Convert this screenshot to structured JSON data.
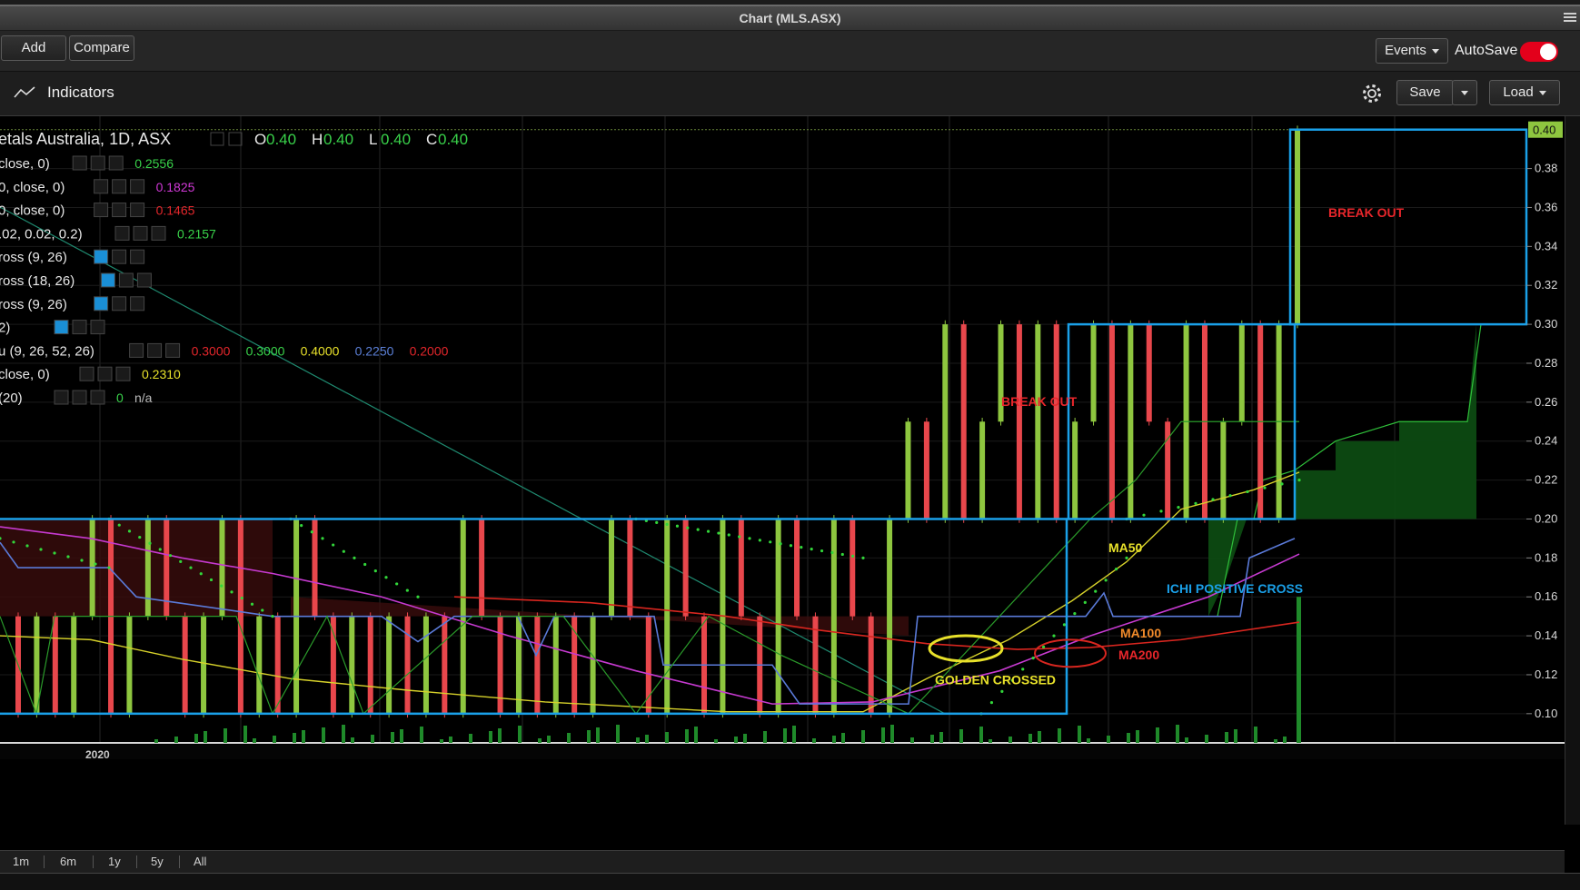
{
  "window": {
    "title": "Chart (MLS.ASX)"
  },
  "toolbar": {
    "add_label": "Add",
    "compare_label": "Compare",
    "events_label": "Events",
    "autosave_label": "AutoSave",
    "autosave_on": true,
    "accent_color": "#e3001b"
  },
  "indicators_bar": {
    "label": "Indicators",
    "save_label": "Save",
    "load_label": "Load"
  },
  "range_buttons": [
    "1m",
    "6m",
    "1y",
    "5y",
    "All"
  ],
  "legend": {
    "instrument": "etals Australia, 1D, ASX",
    "ohlc": [
      {
        "key": "O",
        "value": "0.40"
      },
      {
        "key": "H",
        "value": "0.40"
      },
      {
        "key": "L",
        "value": "0.40"
      },
      {
        "key": "C",
        "value": "0.40"
      }
    ],
    "studies": [
      {
        "name": "close, 0)",
        "values": [
          {
            "text": "0.2556",
            "color": "#39d24a"
          }
        ]
      },
      {
        "name": "0, close, 0)",
        "values": [
          {
            "text": "0.1825",
            "color": "#d038d6"
          }
        ]
      },
      {
        "name": "0, close, 0)",
        "values": [
          {
            "text": "0.1465",
            "color": "#e3262b"
          }
        ]
      },
      {
        "name": ".02, 0.02, 0.2)",
        "values": [
          {
            "text": "0.2157",
            "color": "#39d24a"
          }
        ]
      },
      {
        "name": "ross (9, 26)",
        "values": []
      },
      {
        "name": "ross (18, 26)",
        "values": []
      },
      {
        "name": "ross (9, 26)",
        "values": []
      },
      {
        "name": " 2)",
        "values": []
      },
      {
        "name": "u (9, 26, 52, 26)",
        "values": [
          {
            "text": "0.3000",
            "color": "#e3262b"
          },
          {
            "text": "0.3000",
            "color": "#39d24a"
          },
          {
            "text": "0.4000",
            "color": "#e8e12a"
          },
          {
            "text": "0.2250",
            "color": "#5b7fd6"
          },
          {
            "text": "0.2000",
            "color": "#e3262b"
          }
        ]
      },
      {
        "name": " close, 0)",
        "values": [
          {
            "text": "0.2310",
            "color": "#e8e12a"
          }
        ]
      },
      {
        "name": " (20)",
        "values": [
          {
            "text": "0",
            "color": "#39d24a"
          },
          {
            "text": "n/a",
            "color": "#bbbbbb"
          }
        ]
      }
    ]
  },
  "annotations": {
    "breakout_upper": "BREAK OUT",
    "breakout_mid": "BREAK OUT",
    "ma50": "MA50",
    "ma100": "MA100",
    "ma200": "MA200",
    "ichi_cross": "ICHI POSITIVE CROSS",
    "golden_cross": "GOLDEN CROSSED"
  },
  "chart_data": {
    "type": "candlestick",
    "x_tick_labels": [
      "2020"
    ],
    "y_axis": {
      "ylim": [
        0.085,
        0.405
      ],
      "ticks": [
        "0.10",
        "0.12",
        "0.14",
        "0.16",
        "0.18",
        "0.20",
        "0.22",
        "0.24",
        "0.26",
        "0.28",
        "0.30",
        "0.32",
        "0.34",
        "0.36",
        "0.38"
      ],
      "last_price_label": "0.40"
    },
    "colors": {
      "up": "#8ec63f",
      "down": "#e8474c",
      "ma50": "#d6d12a",
      "ma100": "#c63ad0",
      "ma200": "#d8261f",
      "ichimoku_base": "#5a7ad8",
      "ichimoku_conversion": "#2a9a2a",
      "psar": "#32d63a",
      "box": "#1aa0e8"
    },
    "series": [
      {
        "name": "MA50",
        "values": []
      },
      {
        "name": "MA100",
        "values": []
      },
      {
        "name": "MA200",
        "values": []
      }
    ],
    "candles_close": [
      0.1,
      0.15,
      0.1,
      0.15,
      0.2,
      0.1,
      0.15,
      0.2,
      0.15,
      0.1,
      0.15,
      0.2,
      0.1,
      0.15,
      0.1,
      0.2,
      0.15,
      0.1,
      0.15,
      0.1,
      0.15,
      0.1,
      0.15,
      0.1,
      0.2,
      0.15,
      0.1,
      0.15,
      0.1,
      0.15,
      0.1,
      0.15,
      0.2,
      0.15,
      0.1,
      0.2,
      0.15,
      0.1,
      0.2,
      0.15,
      0.1,
      0.2,
      0.15,
      0.1,
      0.2,
      0.15,
      0.1,
      0.2,
      0.25,
      0.2,
      0.3,
      0.2,
      0.25,
      0.3,
      0.2,
      0.3,
      0.2,
      0.25,
      0.3,
      0.2,
      0.3,
      0.25,
      0.2,
      0.3,
      0.2,
      0.25,
      0.3,
      0.2,
      0.3,
      0.4
    ]
  }
}
